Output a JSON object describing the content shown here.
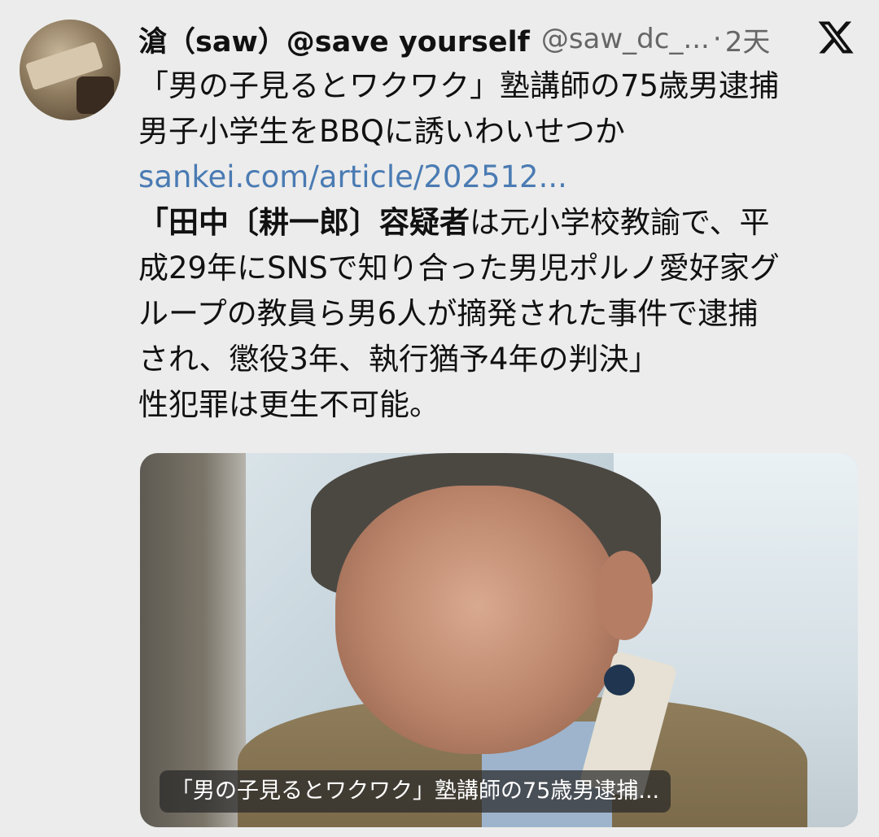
{
  "author": {
    "display_name": "滄（saw）@save yourself",
    "handle": "@saw_dc_...",
    "separator": "·",
    "time": "2天"
  },
  "platform_logo": "x-logo-icon",
  "tweet": {
    "lines": [
      "「男の子見るとワクワク」塾講師の75歳男逮捕",
      "男子小学生をBBQに誘いわいせつか"
    ],
    "link_text": "sankei.com/article/202512...",
    "quote_bold": "「田中〔耕一郎〕容疑者",
    "quote_lines": [
      "は元小学校教諭で、平",
      "成29年にSNSで知り合った男児ポルノ愛好家グ",
      "ループの教員ら男6人が摘発された事件で逮捕",
      "され、懲役3年、執行猶予4年の判決」",
      "性犯罪は更生不可能。"
    ]
  },
  "media": {
    "caption": "「男の子見るとワクワク」塾講師の75歳男逮捕..."
  },
  "colors": {
    "background": "#ececec",
    "link": "#4a7bb3",
    "secondary_text": "#666666"
  }
}
